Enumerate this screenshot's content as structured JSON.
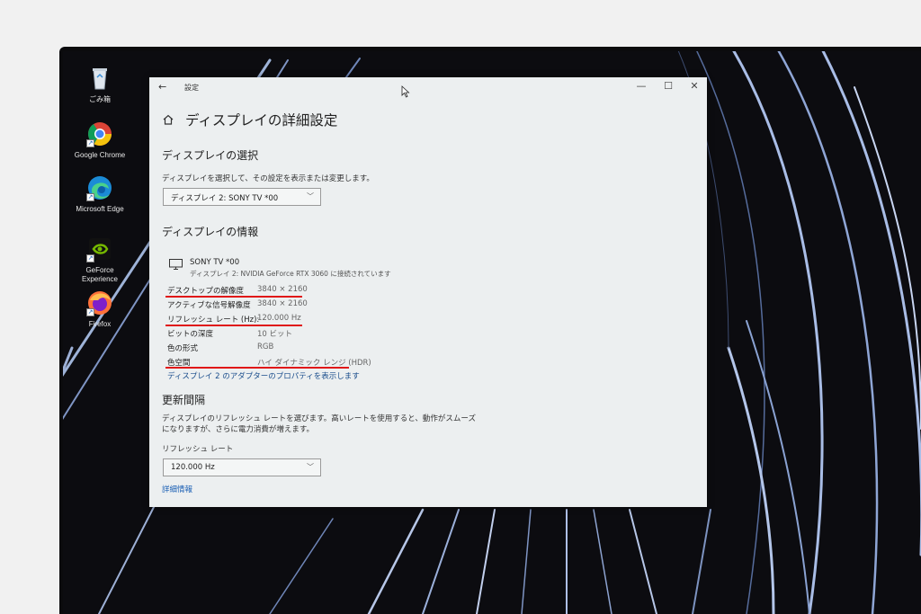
{
  "desktop": {
    "icons": [
      {
        "label": "ごみ箱",
        "icon": "recycle-bin-icon"
      },
      {
        "label": "Google Chrome",
        "icon": "chrome-icon"
      },
      {
        "label": "Microsoft Edge",
        "icon": "edge-icon"
      },
      {
        "label": "GeForce Experience",
        "icon": "geforce-icon"
      },
      {
        "label": "Firefox",
        "icon": "firefox-icon"
      }
    ]
  },
  "window": {
    "title": "設定",
    "page_title": "ディスプレイの詳細設定",
    "controls": {
      "minimize": "—",
      "maximize": "☐",
      "close": "✕"
    },
    "back": "←"
  },
  "display_select": {
    "heading": "ディスプレイの選択",
    "description": "ディスプレイを選択して、その設定を表示または変更します。",
    "selected": "ディスプレイ 2: SONY TV  *00"
  },
  "display_info": {
    "heading": "ディスプレイの情報",
    "name": "SONY TV  *00",
    "subtitle": "ディスプレイ 2: NVIDIA GeForce RTX 3060 に接続されています",
    "rows": [
      {
        "label": "デスクトップの解像度",
        "value": "3840 × 2160"
      },
      {
        "label": "アクティブな信号解像度",
        "value": "3840 × 2160"
      },
      {
        "label": "リフレッシュ レート (Hz):",
        "value": "120.000 Hz"
      },
      {
        "label": "ビットの深度",
        "value": "10 ビット"
      },
      {
        "label": "色の形式",
        "value": "RGB"
      },
      {
        "label": "色空間",
        "value": "ハイ ダイナミック レンジ (HDR)"
      }
    ],
    "adapter_link": "ディスプレイ 2 のアダプターのプロパティを表示します"
  },
  "refresh": {
    "heading": "更新間隔",
    "description_line1": "ディスプレイのリフレッシュ レートを選びます。高いレートを使用すると、動作がスムーズ",
    "description_line2": "になりますが、さらに電力消費が増えます。",
    "label": "リフレッシュ レート",
    "selected": "120.000 Hz",
    "more_link": "詳細情報"
  },
  "colors": {
    "highlight": "#e01818",
    "link": "#1a5fb4",
    "window_bg": "#eceff0"
  }
}
